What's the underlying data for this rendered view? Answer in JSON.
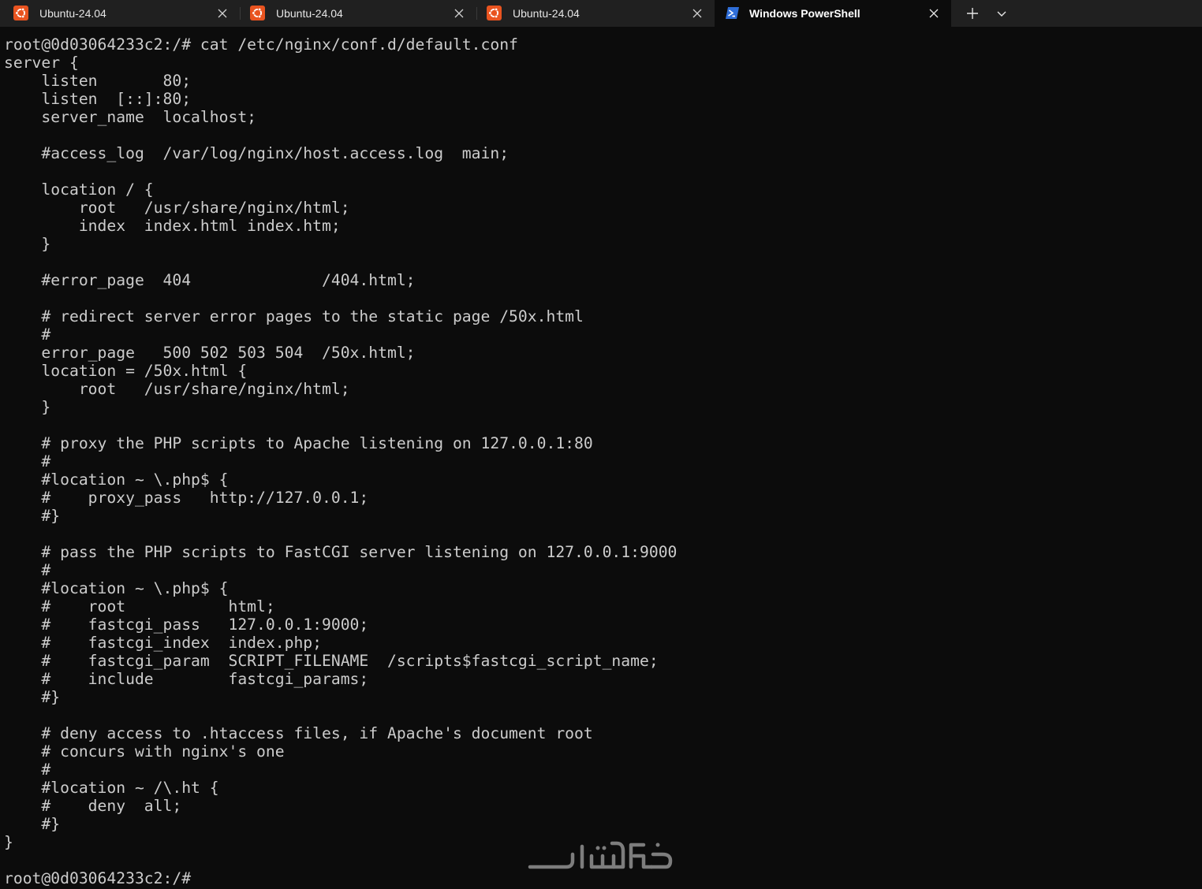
{
  "tabs": [
    {
      "label": "Ubuntu-24.04",
      "icon": "ubuntu-icon",
      "active": false
    },
    {
      "label": "Ubuntu-24.04",
      "icon": "ubuntu-icon",
      "active": false
    },
    {
      "label": "Ubuntu-24.04",
      "icon": "ubuntu-icon",
      "active": false
    },
    {
      "label": "Windows PowerShell",
      "icon": "powershell-icon",
      "active": true
    }
  ],
  "terminal": {
    "lines": [
      "root@0d03064233c2:/# cat /etc/nginx/conf.d/default.conf",
      "server {",
      "    listen       80;",
      "    listen  [::]:80;",
      "    server_name  localhost;",
      "",
      "    #access_log  /var/log/nginx/host.access.log  main;",
      "",
      "    location / {",
      "        root   /usr/share/nginx/html;",
      "        index  index.html index.htm;",
      "    }",
      "",
      "    #error_page  404              /404.html;",
      "",
      "    # redirect server error pages to the static page /50x.html",
      "    #",
      "    error_page   500 502 503 504  /50x.html;",
      "    location = /50x.html {",
      "        root   /usr/share/nginx/html;",
      "    }",
      "",
      "    # proxy the PHP scripts to Apache listening on 127.0.0.1:80",
      "    #",
      "    #location ~ \\.php$ {",
      "    #    proxy_pass   http://127.0.0.1;",
      "    #}",
      "",
      "    # pass the PHP scripts to FastCGI server listening on 127.0.0.1:9000",
      "    #",
      "    #location ~ \\.php$ {",
      "    #    root           html;",
      "    #    fastcgi_pass   127.0.0.1:9000;",
      "    #    fastcgi_index  index.php;",
      "    #    fastcgi_param  SCRIPT_FILENAME  /scripts$fastcgi_script_name;",
      "    #    include        fastcgi_params;",
      "    #}",
      "",
      "    # deny access to .htaccess files, if Apache's document root",
      "    # concurs with nginx's one",
      "    #",
      "    #location ~ /\\.ht {",
      "    #    deny  all;",
      "    #}",
      "}",
      "",
      "root@0d03064233c2:/#"
    ]
  },
  "watermark": {
    "text": "خمسات"
  },
  "colors": {
    "tabbar_bg": "#202020",
    "active_tab_bg": "#0c0c0c",
    "terminal_bg": "#0c0c0c",
    "terminal_fg": "#cccccc",
    "ubuntu_orange": "#e95420",
    "powershell_blue": "#2f6ed8"
  }
}
